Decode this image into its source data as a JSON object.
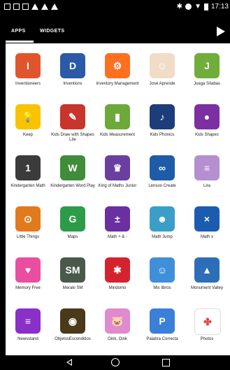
{
  "status_bar": {
    "time": "17:13",
    "left_icons": [
      "image-icon",
      "photo-icon",
      "sim-icon",
      "warning-icon",
      "warning-icon",
      "warning-icon"
    ],
    "right_icons": [
      "bluetooth-icon",
      "do-not-disturb-icon",
      "wifi-icon",
      "battery-icon"
    ]
  },
  "tabs": {
    "apps": "APPS",
    "widgets": "WIDGETS"
  },
  "apps": [
    {
      "label": "Inventioneers",
      "icon": "inventioneers-icon",
      "color": "#e0552c",
      "glyph": "I"
    },
    {
      "label": "Inventions",
      "icon": "inventions-icon",
      "color": "#2a5aa8",
      "glyph": "D"
    },
    {
      "label": "Inventory Management",
      "icon": "forklift-icon",
      "color": "#ff6f20",
      "glyph": "⚙"
    },
    {
      "label": "José Aprende",
      "icon": "jose-aprende-icon",
      "color": "#f2dcc8",
      "glyph": "☺"
    },
    {
      "label": "Juega Sílabas",
      "icon": "juega-silabas-icon",
      "color": "#6fae3a",
      "glyph": "J"
    },
    {
      "label": "Keep",
      "icon": "keep-bulb-icon",
      "color": "#f9c300",
      "glyph": "💡"
    },
    {
      "label": "Kids Draw with Shapes Lite",
      "icon": "kids-draw-icon",
      "color": "#c7352d",
      "glyph": "✎"
    },
    {
      "label": "Kids Measurement",
      "icon": "kids-measurement-icon",
      "color": "#6da83a",
      "glyph": "▮"
    },
    {
      "label": "Kids Phonics",
      "icon": "kids-phonics-icon",
      "color": "#1c3d7a",
      "glyph": "♪"
    },
    {
      "label": "Kids Shapes",
      "icon": "kids-shapes-icon",
      "color": "#7c2fa0",
      "glyph": "●"
    },
    {
      "label": "Kindergarten Math",
      "icon": "kindergarten-math-icon",
      "color": "#3b3b3b",
      "glyph": "1"
    },
    {
      "label": "Kindergarten Word Play",
      "icon": "kindergarten-wordplay-icon",
      "color": "#3f8c3b",
      "glyph": "W"
    },
    {
      "label": "King of Maths Junior",
      "icon": "king-of-maths-icon",
      "color": "#6a3fa0",
      "glyph": "♛"
    },
    {
      "label": "Lensoo Create",
      "icon": "lensoo-create-icon",
      "color": "#1e5ca8",
      "glyph": "∞"
    },
    {
      "label": "Lira",
      "icon": "lira-books-icon",
      "color": "#b58fd0",
      "glyph": "≡"
    },
    {
      "label": "Little Things",
      "icon": "little-things-owl-icon",
      "color": "#e07a1c",
      "glyph": "⊙"
    },
    {
      "label": "Maps",
      "icon": "maps-icon",
      "color": "#2d9c4a",
      "glyph": "G"
    },
    {
      "label": "Math + & -",
      "icon": "math-plus-minus-icon",
      "color": "#6a2fa0",
      "glyph": "±"
    },
    {
      "label": "Math Jump",
      "icon": "math-jump-icon",
      "color": "#3a9ec9",
      "glyph": "☻"
    },
    {
      "label": "Math x",
      "icon": "math-x-icon",
      "color": "#1b5cb0",
      "glyph": "×"
    },
    {
      "label": "Memory Free",
      "icon": "memory-free-icon",
      "color": "#e94ea0",
      "glyph": "♥"
    },
    {
      "label": "Meraki SM",
      "icon": "meraki-sm-icon",
      "color": "#4a5a4a",
      "glyph": "SM"
    },
    {
      "label": "Mindomo",
      "icon": "mindomo-icon",
      "color": "#d4232f",
      "glyph": "✱"
    },
    {
      "label": "Mis libros",
      "icon": "mis-libros-icon",
      "color": "#3f90d9",
      "glyph": "☺"
    },
    {
      "label": "Monument Valley",
      "icon": "monument-valley-icon",
      "color": "#2c6fb8",
      "glyph": "▲"
    },
    {
      "label": "Newsstand",
      "icon": "newsstand-icon",
      "color": "#8b2fc9",
      "glyph": "≡"
    },
    {
      "label": "ObjetosEscondidos",
      "icon": "objetos-escondidos-icon",
      "color": "#4a3a1a",
      "glyph": "◉"
    },
    {
      "label": "Oink, Oink",
      "icon": "oink-oink-icon",
      "color": "#e08ad0",
      "glyph": "🐷"
    },
    {
      "label": "Palabra Correcta",
      "icon": "palabra-correcta-icon",
      "color": "#3a7fd9",
      "glyph": "P"
    },
    {
      "label": "Photos",
      "icon": "photos-pinwheel-icon",
      "color": "#ffffff",
      "glyph": "✤"
    }
  ],
  "nav": {
    "back": "back-icon",
    "home": "home-icon",
    "recents": "recents-icon"
  }
}
